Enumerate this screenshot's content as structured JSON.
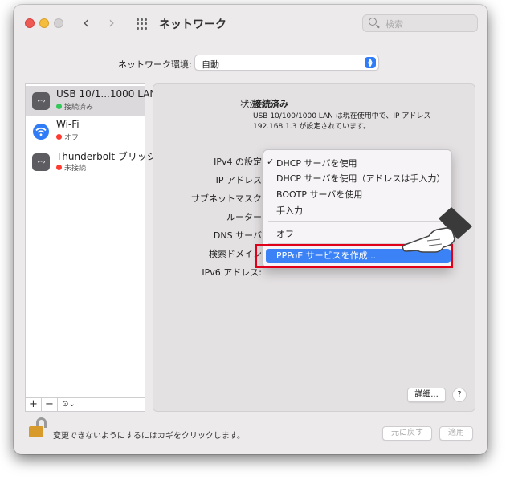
{
  "window": {
    "title": "ネットワーク"
  },
  "search": {
    "placeholder": "検索"
  },
  "location": {
    "label": "ネットワーク環境:",
    "value": "自動"
  },
  "services": [
    {
      "name": "USB 10/1...1000 LAN",
      "status": "接続済み",
      "status_color": "#34c759",
      "icon": "ethernet-icon",
      "selected": true
    },
    {
      "name": "Wi-Fi",
      "status": "オフ",
      "status_color": "#ff3b30",
      "icon": "wifi-icon",
      "selected": false
    },
    {
      "name": "Thunderbolt ブリッジ",
      "status": "未接続",
      "status_color": "#ff3b30",
      "icon": "ethernet-icon",
      "selected": false
    }
  ],
  "sidebar_toolbar": {
    "add": "+",
    "remove": "−",
    "action": "⊙⌄"
  },
  "detail": {
    "status_label": "状況:",
    "status_value": "接続済み",
    "status_desc": "USB 10/100/1000 LAN は現在使用中で、IP アドレス 192.168.1.3 が設定されています。",
    "labels": {
      "ipv4": "IPv4 の設定",
      "ip": "IP アドレス",
      "subnet": "サブネットマスク",
      "router": "ルーター",
      "dns": "DNS サーバ",
      "search_domain": "検索ドメイン",
      "ipv6": "IPv6 アドレス:"
    }
  },
  "menu": {
    "checked_item": "DHCP サーバを使用",
    "items": [
      "DHCP サーバを使用",
      "DHCP サーバを使用（アドレスは手入力）",
      "BOOTP サーバを使用",
      "手入力"
    ],
    "off": "オフ",
    "highlighted": "PPPoE サービスを作成..."
  },
  "buttons": {
    "advanced": "詳細...",
    "help": "?",
    "revert": "元に戻す",
    "apply": "適用"
  },
  "lock_text": "変更できないようにするにはカギをクリックします。",
  "colors": {
    "accent": "#3c82f7",
    "callout": "#e0001a"
  }
}
